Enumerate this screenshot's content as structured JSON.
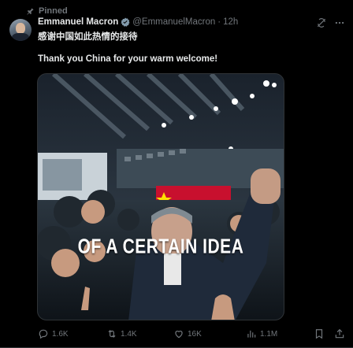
{
  "pinned": {
    "label": "Pinned",
    "icon": "pin-icon"
  },
  "author": {
    "name": "Emmanuel Macron",
    "handle": "@EmmanuelMacron",
    "separator": "·",
    "time": "12h",
    "verified_color": "#1d9bf0"
  },
  "tweet": {
    "text_zh": "感谢中国如此热情的接待",
    "text_en": "Thank you China for your warm welcome!",
    "media_caption": "OF A CERTAIN IDEA"
  },
  "actions": {
    "replies": "1.6K",
    "reposts": "1.4K",
    "likes": "16K",
    "views": "1.1M"
  },
  "colors": {
    "background": "#000000",
    "text": "#e7e9ea",
    "muted": "#71767b",
    "accent": "#1d9bf0"
  }
}
